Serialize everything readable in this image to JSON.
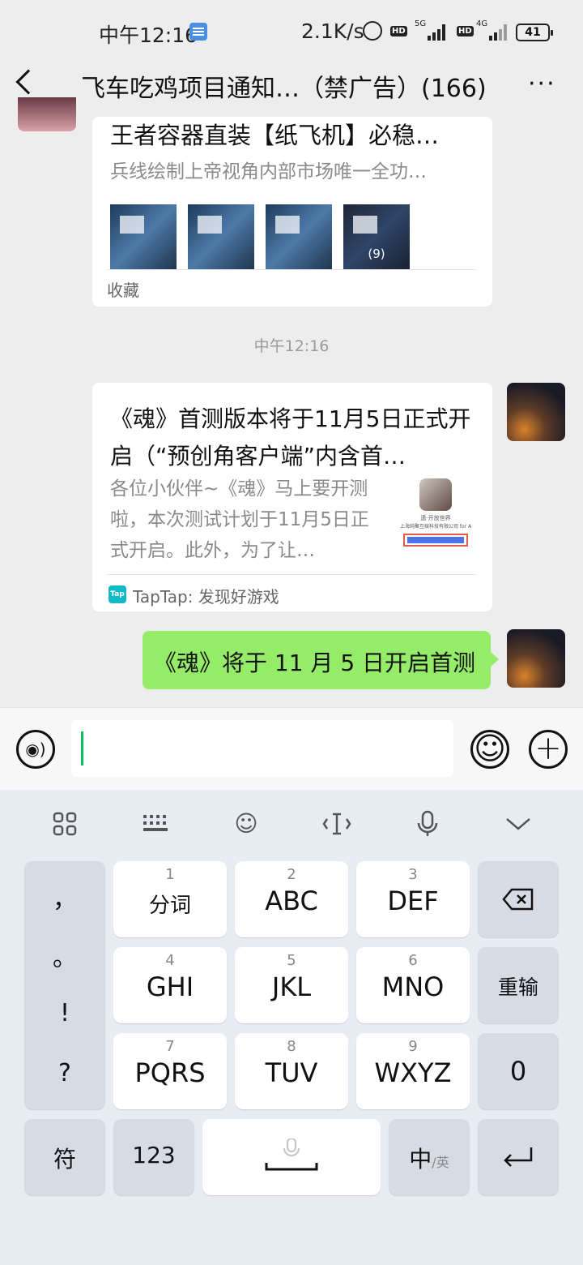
{
  "status_bar": {
    "time": "中午12:16",
    "net_speed": "2.1K/s",
    "hd1": "HD",
    "sig1_label": "5G",
    "hd2": "HD",
    "sig2_label": "4G",
    "battery": "41"
  },
  "nav": {
    "title": "飞车吃鸡项目通知…（禁广告）(166)",
    "more": "···"
  },
  "messages": {
    "card1": {
      "title": "王者容器直装【纸飞机】必稳…",
      "subtitle": "兵线绘制上帝视角内部市场唯一全功…",
      "thumb_count": "(9)",
      "footer": "收藏"
    },
    "timestamp": "中午12:16",
    "card2": {
      "title": "《魂》首测版本将于11月5日正式开启（“预创角客户端”内含首…",
      "description": "各位小伙伴~《魂》马上要开测啦，本次测试计划于11月5日正式开启。此外，为了让…",
      "thumb_text1": "遗·开放世界",
      "thumb_text2": "上海纯聚互娱科技有限公司 for A",
      "source_icon": "Tap",
      "source": "TapTap: 发现好游戏"
    },
    "sent": {
      "text": "《魂》将于 11 月 5 日开启首测"
    }
  },
  "input_bar": {
    "voice_icon": "voice-icon",
    "value": "",
    "emoji_icon": "emoji-icon",
    "plus_icon": "plus-icon"
  },
  "keyboard": {
    "toolbar": [
      "apps-grid-icon",
      "keyboard-icon",
      "emoji-icon",
      "cursor-icon",
      "mic-icon",
      "chevron-down-icon"
    ],
    "punctuation": [
      "，",
      "。",
      "!",
      "?"
    ],
    "keys": [
      {
        "num": "1",
        "label": "分词"
      },
      {
        "num": "2",
        "label": "ABC"
      },
      {
        "num": "3",
        "label": "DEF"
      },
      {
        "num": "4",
        "label": "GHI"
      },
      {
        "num": "5",
        "label": "JKL"
      },
      {
        "num": "6",
        "label": "MNO"
      },
      {
        "num": "7",
        "label": "PQRS"
      },
      {
        "num": "8",
        "label": "TUV"
      },
      {
        "num": "9",
        "label": "WXYZ"
      }
    ],
    "reinput": "重输",
    "zero": "0",
    "symbol": "符",
    "num123": "123",
    "lang_main": "中",
    "lang_sub": "/英"
  }
}
